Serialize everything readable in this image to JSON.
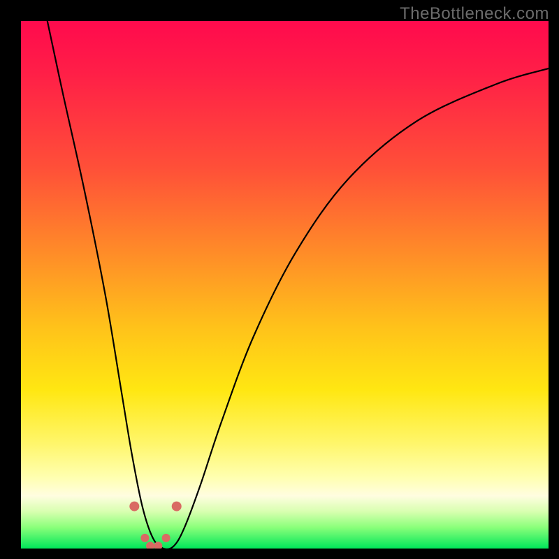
{
  "watermark": "TheBottleneck.com",
  "colors": {
    "frame": "#000000",
    "curve_stroke": "#000000",
    "dot_fill": "#d96a63",
    "gradient_stops": [
      "#ff0a4d",
      "#ff5038",
      "#ff8c28",
      "#ffc21a",
      "#ffe712",
      "#fff66a",
      "#ffffb0",
      "#fffde0",
      "#d8ffb0",
      "#8aff7a",
      "#00e65a"
    ]
  },
  "chart_data": {
    "type": "line",
    "title": "",
    "xlabel": "",
    "ylabel": "",
    "xlim": [
      0,
      100
    ],
    "ylim": [
      0,
      100
    ],
    "note": "Curve shape estimated from pixels; no axis ticks or labels present in image.",
    "series": [
      {
        "name": "bottleneck-curve",
        "x": [
          5,
          8,
          12,
          16,
          19,
          21,
          23,
          25,
          27,
          29,
          31,
          34,
          38,
          44,
          52,
          62,
          75,
          90,
          100
        ],
        "y": [
          100,
          86,
          68,
          48,
          30,
          18,
          8,
          2,
          0,
          0.5,
          4,
          12,
          24,
          40,
          56,
          70,
          81,
          88,
          91
        ]
      }
    ],
    "markers": {
      "name": "valley-dots",
      "x": [
        21.5,
        23.5,
        24.5,
        26,
        27.5,
        29.5
      ],
      "y": [
        8,
        2,
        0.5,
        0.5,
        2,
        8
      ],
      "sizes": [
        7,
        6,
        6,
        6,
        6,
        7
      ]
    }
  }
}
